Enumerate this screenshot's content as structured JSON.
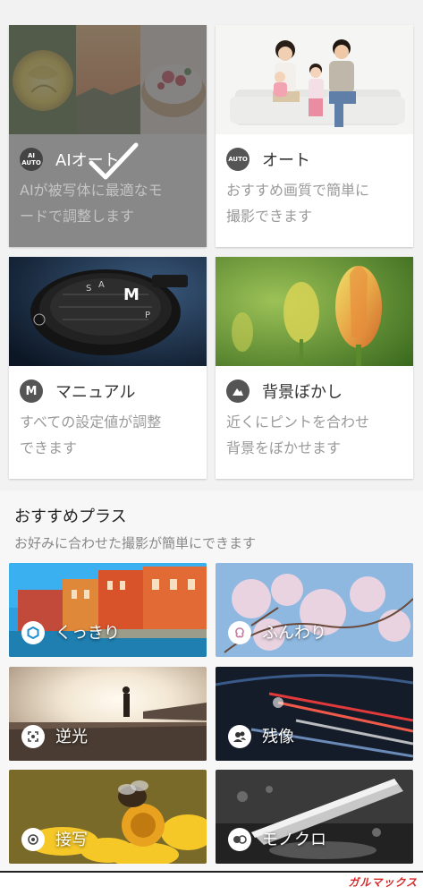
{
  "modes": [
    {
      "id": "ai-auto",
      "title": "AIオート",
      "desc": [
        "AIが被写体に最適なモ",
        "ードで調整します"
      ],
      "icon_text": "AI AUTO",
      "icon": "ai-auto-icon",
      "selected": true
    },
    {
      "id": "auto",
      "title": "オート",
      "desc": [
        "おすすめ画質で簡単に",
        "撮影できます"
      ],
      "icon_text": "AUTO",
      "icon": "auto-icon",
      "selected": false
    },
    {
      "id": "manual",
      "title": "マニュアル",
      "desc": [
        "すべての設定値が調整",
        "できます"
      ],
      "icon_text": "M",
      "icon": "manual-m-icon",
      "selected": false
    },
    {
      "id": "bokeh",
      "title": "背景ぼかし",
      "desc": [
        "近くにピントを合わせ",
        "背景をぼかせます"
      ],
      "icon_text": "",
      "icon": "mountain-icon",
      "selected": false
    }
  ],
  "plus_section": {
    "title": "おすすめプラス",
    "subtitle": "お好みに合わせた撮影が簡単にできます",
    "items": [
      {
        "label": "くっきり",
        "icon": "hexagon-icon"
      },
      {
        "label": "ふんわり",
        "icon": "soft-flower-icon"
      },
      {
        "label": "逆光",
        "icon": "backlight-icon"
      },
      {
        "label": "残像",
        "icon": "people-icon"
      },
      {
        "label": "接写",
        "icon": "macro-icon"
      },
      {
        "label": "モノクロ",
        "icon": "mono-icon"
      }
    ]
  },
  "watermark": "ガルマックス"
}
